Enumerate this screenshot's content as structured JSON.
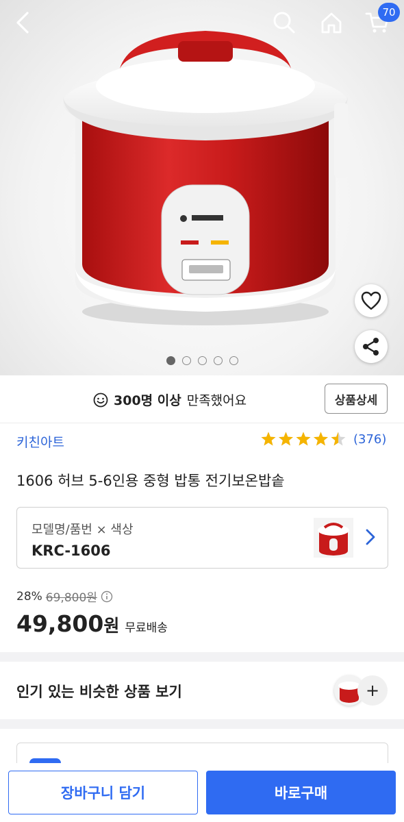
{
  "header": {
    "back_icon": "chevron-left-icon",
    "search_icon": "search-icon",
    "home_icon": "home-icon",
    "cart_icon": "cart-icon",
    "cart_count": "70"
  },
  "gallery": {
    "total_images": 5,
    "active_index": 0,
    "like_icon": "heart-icon",
    "share_icon": "share-icon"
  },
  "satisfaction": {
    "icon": "smile-icon",
    "highlight": "300명 이상",
    "text": "만족했어요",
    "detail_button": "상품상세"
  },
  "product": {
    "brand": "키친아트",
    "rating": 4.5,
    "review_count": "(376)",
    "title": "1606 허브 5-6인용 중형 밥통 전기보온밥솥"
  },
  "option": {
    "label": "모델명/품번 × 색상",
    "value": "KRC-1606"
  },
  "price": {
    "discount_rate": "28%",
    "original_price": "69,800원",
    "final_price": "49,800",
    "currency": "원",
    "shipping": "무료배송"
  },
  "similar": {
    "title": "인기 있는 비슷한 상품 보기",
    "plus": "+"
  },
  "bottom": {
    "add_to_cart": "장바구니 담기",
    "buy_now": "바로구매"
  },
  "colors": {
    "accent": "#2f6bf2",
    "brand_link": "#2c64d8",
    "star": "#f5b400",
    "product_red": "#c81b1b"
  }
}
